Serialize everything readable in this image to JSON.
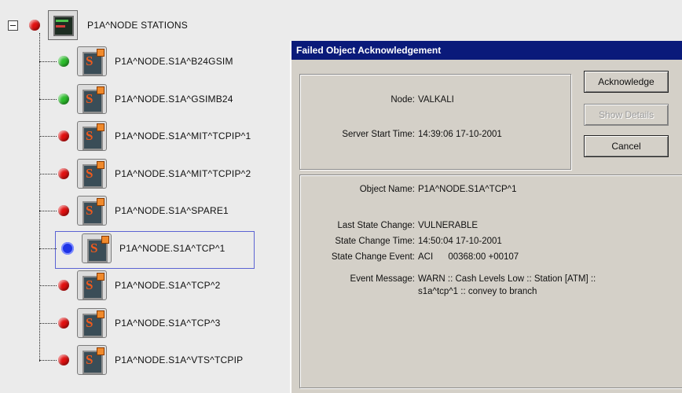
{
  "tree": {
    "root": {
      "label": "P1A^NODE   STATIONS",
      "status": "red"
    },
    "children": [
      {
        "label": "P1A^NODE.S1A^B24GSIM",
        "status": "green"
      },
      {
        "label": "P1A^NODE.S1A^GSIMB24",
        "status": "green"
      },
      {
        "label": "P1A^NODE.S1A^MIT^TCPIP^1",
        "status": "red"
      },
      {
        "label": "P1A^NODE.S1A^MIT^TCPIP^2",
        "status": "red"
      },
      {
        "label": "P1A^NODE.S1A^SPARE1",
        "status": "red"
      },
      {
        "label": "P1A^NODE.S1A^TCP^1",
        "status": "blue"
      },
      {
        "label": "P1A^NODE.S1A^TCP^2",
        "status": "red"
      },
      {
        "label": "P1A^NODE.S1A^TCP^3",
        "status": "red"
      },
      {
        "label": "P1A^NODE.S1A^VTS^TCPIP",
        "status": "red"
      }
    ]
  },
  "dialog": {
    "title": "Failed Object Acknowledgement",
    "node_label": "Node:",
    "node_value": "VALKALI",
    "server_start_label": "Server Start Time:",
    "server_start_value": "14:39:06  17-10-2001",
    "object_name_label": "Object Name:",
    "object_name_value": "P1A^NODE.S1A^TCP^1",
    "last_state_label": "Last State Change:",
    "last_state_value": "VULNERABLE",
    "state_time_label": "State Change Time:",
    "state_time_value": "14:50:04  17-10-2001",
    "state_event_label": "State Change Event:",
    "state_event_value": "ACI      00368:00 +00107",
    "event_message_label": "Event Message:",
    "event_message_line1": "WARN :: Cash Levels Low :: Station [ATM] ::",
    "event_message_line2": "s1a^tcp^1 :: convey to branch",
    "buttons": {
      "acknowledge": "Acknowledge",
      "show_details": "Show Details",
      "cancel": "Cancel"
    }
  },
  "colors": {
    "status_red": "#e01010",
    "status_green": "#2cbd2c",
    "status_blue": "#1e33e6",
    "titlebar": "#0a1a7a"
  }
}
